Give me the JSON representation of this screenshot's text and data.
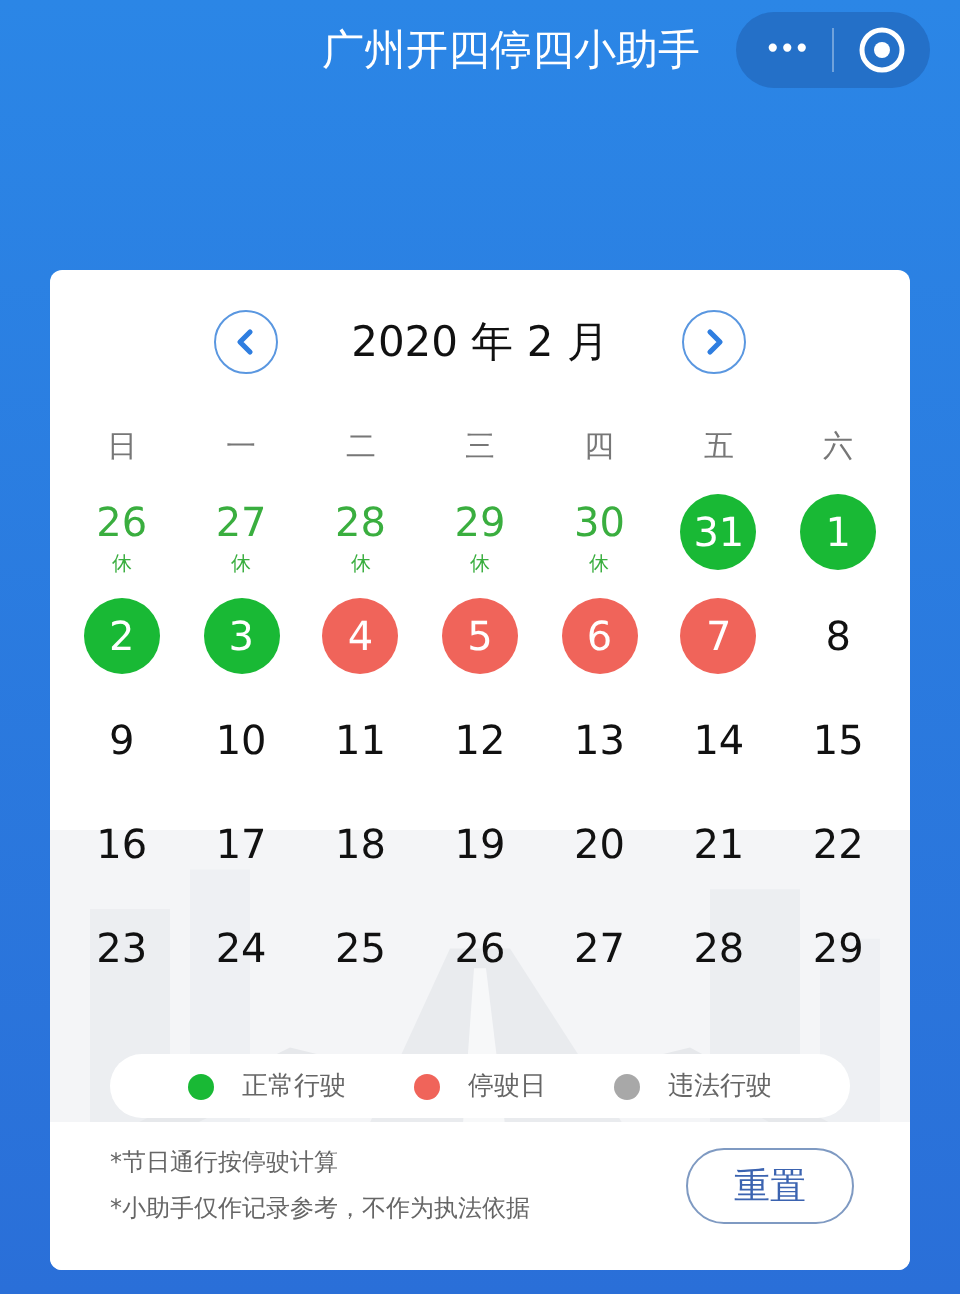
{
  "title": "广州开四停四小助手",
  "capsule": {
    "more": "•••"
  },
  "calendar": {
    "month": "2020 年 2 月",
    "weekdays": [
      "日",
      "一",
      "二",
      "三",
      "四",
      "五",
      "六"
    ],
    "days": [
      {
        "label": "26",
        "kind": "holiday",
        "note": "休"
      },
      {
        "label": "27",
        "kind": "holiday",
        "note": "休"
      },
      {
        "label": "28",
        "kind": "holiday",
        "note": "休"
      },
      {
        "label": "29",
        "kind": "holiday",
        "note": "休"
      },
      {
        "label": "30",
        "kind": "holiday",
        "note": "休"
      },
      {
        "label": "31",
        "kind": "normal"
      },
      {
        "label": "1",
        "kind": "normal"
      },
      {
        "label": "2",
        "kind": "normal"
      },
      {
        "label": "3",
        "kind": "normal"
      },
      {
        "label": "4",
        "kind": "stop"
      },
      {
        "label": "5",
        "kind": "stop"
      },
      {
        "label": "6",
        "kind": "stop"
      },
      {
        "label": "7",
        "kind": "stop"
      },
      {
        "label": "8",
        "kind": "plain"
      },
      {
        "label": "9",
        "kind": "plain"
      },
      {
        "label": "10",
        "kind": "plain"
      },
      {
        "label": "11",
        "kind": "plain"
      },
      {
        "label": "12",
        "kind": "plain"
      },
      {
        "label": "13",
        "kind": "plain"
      },
      {
        "label": "14",
        "kind": "plain"
      },
      {
        "label": "15",
        "kind": "plain"
      },
      {
        "label": "16",
        "kind": "plain"
      },
      {
        "label": "17",
        "kind": "plain"
      },
      {
        "label": "18",
        "kind": "plain"
      },
      {
        "label": "19",
        "kind": "plain"
      },
      {
        "label": "20",
        "kind": "plain"
      },
      {
        "label": "21",
        "kind": "plain"
      },
      {
        "label": "22",
        "kind": "plain"
      },
      {
        "label": "23",
        "kind": "plain"
      },
      {
        "label": "24",
        "kind": "plain"
      },
      {
        "label": "25",
        "kind": "plain"
      },
      {
        "label": "26",
        "kind": "plain"
      },
      {
        "label": "27",
        "kind": "plain"
      },
      {
        "label": "28",
        "kind": "plain"
      },
      {
        "label": "29",
        "kind": "plain"
      }
    ]
  },
  "legend": [
    {
      "label": "正常行驶",
      "color": "#19b935"
    },
    {
      "label": "停驶日",
      "color": "#f0645a"
    },
    {
      "label": "违法行驶",
      "color": "#a8a8a8"
    }
  ],
  "notes": [
    "*节日通行按停驶计算",
    "*小助手仅作记录参考，不作为执法依据"
  ],
  "reset_button": "重置"
}
